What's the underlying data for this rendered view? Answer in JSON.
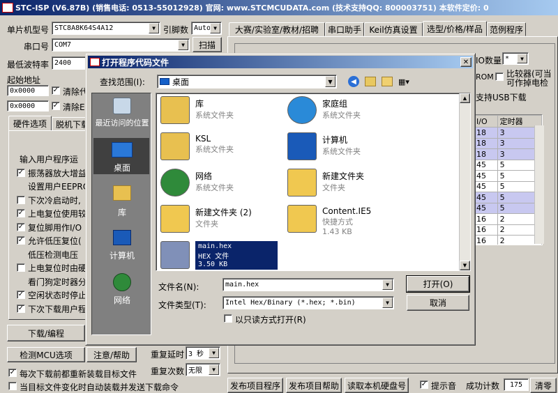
{
  "app": {
    "title": "STC-ISP (V6.87B) (销售电话: 0513-55012928) 官网: www.STCMCUDATA.com (技术支持QQ: 800003751) 本软件定价: 0",
    "mcu_type_label": "单片机型号",
    "mcu_type_value": "STC8A8K64S4A12",
    "pins_label": "引脚数",
    "pins_value": "Auto",
    "port_label": "串口号",
    "port_value": "COM7",
    "scan_button": "扫描",
    "baud_label": "最低波特率",
    "baud_value": "2400",
    "start_addr_label": "起始地址",
    "addr1_value": "0x0000",
    "addr2_value": "0x0000",
    "clear_label1": "清除代",
    "clear_label2": "清除EI",
    "tabs_left": [
      "硬件选项",
      "脱机下载"
    ],
    "hw_options": [
      {
        "label": "输入用户程序运行",
        "check": null
      },
      {
        "label": "振荡器放大增益",
        "check": true
      },
      {
        "label": "设置用户EEPROM",
        "check": null
      },
      {
        "label": "下次冷启动时,",
        "check": false
      },
      {
        "label": "上电复位使用较",
        "check": true
      },
      {
        "label": "复位脚用作I/O",
        "check": true
      },
      {
        "label": "允许低压复位(",
        "check": true
      },
      {
        "label": "低压检测电压",
        "check": null
      },
      {
        "label": "上电复位时由硬",
        "check": false
      },
      {
        "label": "看门狗定时器分",
        "check": null
      },
      {
        "label": "空闲状态时停止",
        "check": true
      },
      {
        "label": "下次下载用户程",
        "check": true
      }
    ],
    "download_button": "下载/编程",
    "detect_button": "检测MCU选项",
    "help_button": "注意/帮助",
    "repeat_delay_label": "重复延时",
    "repeat_delay_value": "3 秒",
    "repeat_count_label": "重复次数",
    "repeat_count_value": "无限",
    "reload_label": "每次下载前都重新装载目标文件",
    "auto_label": "当目标文件变化时自动装载并发送下载命令",
    "publish_button": "发布项目程序",
    "publish_help_button": "发布项目帮助",
    "read_disk_button": "读取本机硬盘号",
    "sound_label": "提示音",
    "success_label": "成功计数",
    "success_value": "175",
    "clear_button": "清零",
    "tabs_right": [
      "大赛/实验室/教材/招聘",
      "串口助手",
      "Keil仿真设置",
      "选型/价格/样品",
      "范例程序"
    ],
    "right_io_label": "IO数量",
    "right_io_value": "*",
    "right_compare": "比较器(可当",
    "right_rom": "ROM",
    "right_adc": "可作掉电检",
    "right_usb": "支持USB下载",
    "right_table_headers": [
      "I/O",
      "定时器"
    ],
    "right_table_rows": [
      [
        "18",
        "3"
      ],
      [
        "18",
        "3"
      ],
      [
        "18",
        "3"
      ],
      [
        "45",
        "5"
      ],
      [
        "45",
        "5"
      ],
      [
        "45",
        "5"
      ],
      [
        "45",
        "5"
      ],
      [
        "45",
        "5"
      ],
      [
        "16",
        "2"
      ],
      [
        "16",
        "2"
      ],
      [
        "16",
        "2"
      ]
    ]
  },
  "dialog": {
    "title": "打开程序代码文件",
    "lookin_label": "查找范围(I):",
    "lookin_value": "桌面",
    "nav": [
      "最近访问的位置",
      "桌面",
      "库",
      "计算机",
      "网络"
    ],
    "files": [
      {
        "name": "库",
        "type": "系统文件夹",
        "icon": "library-folder-icon"
      },
      {
        "name": "家庭组",
        "type": "系统文件夹",
        "icon": "homegroup-icon"
      },
      {
        "name": "KSL",
        "type": "系统文件夹",
        "icon": "user-folder-icon"
      },
      {
        "name": "计算机",
        "type": "系统文件夹",
        "icon": "computer-icon"
      },
      {
        "name": "网络",
        "type": "系统文件夹",
        "icon": "network-icon"
      },
      {
        "name": "新建文件夹",
        "type": "文件夹",
        "icon": "folder-icon"
      },
      {
        "name": "新建文件夹 (2)",
        "type": "文件夹",
        "icon": "folder-icon"
      },
      {
        "name": "Content.IE5",
        "type": "快捷方式",
        "size": "1.43 KB",
        "icon": "shortcut-folder-icon"
      },
      {
        "name": "main.hex",
        "type": "HEX 文件",
        "size": "3.50 KB",
        "icon": "hex-file-icon"
      }
    ],
    "filename_label": "文件名(N):",
    "filename_value": "main.hex",
    "filetype_label": "文件类型(T):",
    "filetype_value": "Intel Hex/Binary (*.hex; *.bin)",
    "readonly_label": "以只读方式打开(R)",
    "open_button": "打开(O)",
    "cancel_button": "取消",
    "close_glyph": "✕"
  }
}
